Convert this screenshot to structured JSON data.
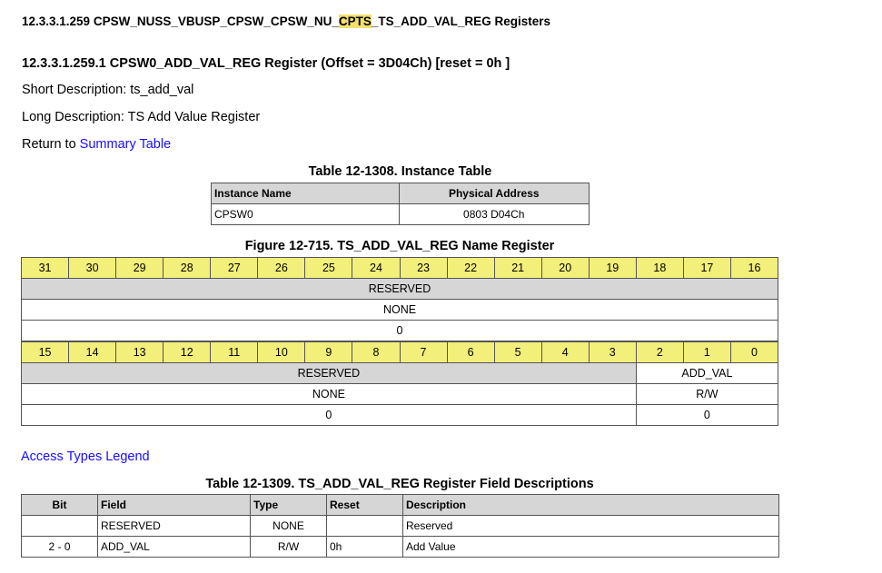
{
  "section_title": {
    "prefix": "12.3.3.1.259 CPSW_NUSS_VBUSP_CPSW_CPSW_NU_",
    "highlight": "CPTS",
    "suffix": "_TS_ADD_VAL_REG Registers"
  },
  "register_title": "12.3.3.1.259.1 CPSW0_ADD_VAL_REG Register (Offset = 3D04Ch) [reset = 0h ]",
  "short_description": "Short Description: ts_add_val",
  "long_description": "Long Description: TS Add Value Register",
  "return_to": {
    "prefix": "Return to ",
    "link": "Summary Table"
  },
  "instance_table": {
    "caption": "Table 12-1308. Instance Table",
    "headers": [
      "Instance Name",
      "Physical Address"
    ],
    "rows": [
      [
        "CPSW0",
        "0803 D04Ch"
      ]
    ]
  },
  "register_figure": {
    "caption": "Figure 12-715. TS_ADD_VAL_REG Name Register",
    "upper_bits": [
      "31",
      "30",
      "29",
      "28",
      "27",
      "26",
      "25",
      "24",
      "23",
      "22",
      "21",
      "20",
      "19",
      "18",
      "17",
      "16"
    ],
    "upper_field": {
      "name": "RESERVED",
      "type": "NONE",
      "reset": "0"
    },
    "lower_bits": [
      "15",
      "14",
      "13",
      "12",
      "11",
      "10",
      "9",
      "8",
      "7",
      "6",
      "5",
      "4",
      "3",
      "2",
      "1",
      "0"
    ],
    "lower_fields": [
      {
        "name": "RESERVED",
        "type": "NONE",
        "reset": "0"
      },
      {
        "name": "ADD_VAL",
        "type": "R/W",
        "reset": "0"
      }
    ]
  },
  "access_types_legend": "Access Types Legend",
  "field_table": {
    "caption": "Table 12-1309. TS_ADD_VAL_REG Register Field Descriptions",
    "headers": [
      "Bit",
      "Field",
      "Type",
      "Reset",
      "Description"
    ],
    "rows": [
      {
        "bit": "",
        "field": "RESERVED",
        "type": "NONE",
        "reset": "",
        "description": "Reserved"
      },
      {
        "bit": "2 - 0",
        "field": "ADD_VAL",
        "type": "R/W",
        "reset": "0h",
        "description": "Add Value"
      }
    ]
  }
}
